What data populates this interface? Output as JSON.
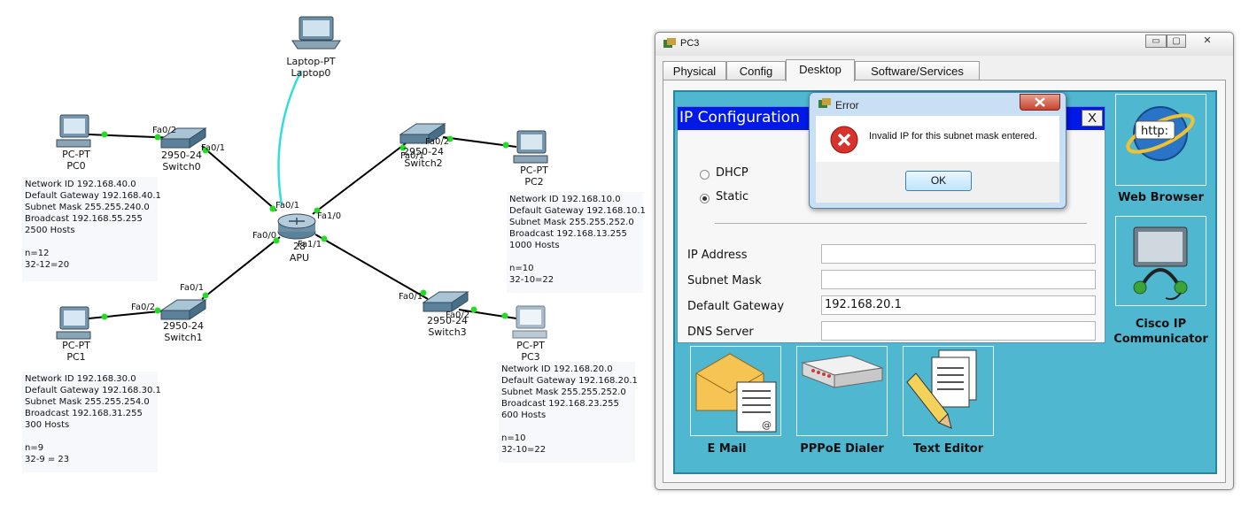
{
  "topology": {
    "devices": {
      "laptop0": {
        "type": "Laptop-PT",
        "name": "Laptop0"
      },
      "pc0": {
        "type": "PC-PT",
        "name": "PC0"
      },
      "pc1": {
        "type": "PC-PT",
        "name": "PC1"
      },
      "pc2": {
        "type": "PC-PT",
        "name": "PC2"
      },
      "pc3": {
        "type": "PC-PT",
        "name": "PC3"
      },
      "switch0": {
        "type": "2950-24",
        "name": "Switch0"
      },
      "switch1": {
        "type": "2950-24",
        "name": "Switch1"
      },
      "switch2": {
        "type": "2950-24",
        "name": "Switch2"
      },
      "switch3": {
        "type": "2950-24",
        "name": "Switch3"
      },
      "router": {
        "type": "28",
        "name": "APU"
      }
    },
    "ports": {
      "sw0_fa02": "Fa0/2",
      "sw0_fa01": "Fa0/1",
      "sw1_fa02": "Fa0/2",
      "sw1_fa01": "Fa0/1",
      "sw2_fa02": "Fa0/2",
      "sw2_fa01": "Fa0/1",
      "sw3_fa01": "Fa0/1",
      "sw3_fa02": "Fa0/2",
      "r_fa01": "Fa0/1",
      "r_fa10": "Fa1/0",
      "r_fa00": "Fa0/0",
      "r_fa11": "Fa1/1"
    },
    "notes": {
      "pc0": "Network ID 192.168.40.0\nDefault Gateway 192.168.40.1\nSubnet Mask 255.255.240.0\nBroadcast 192.168.55.255\n2500 Hosts\n\nn=12\n32-12=20",
      "pc1": "Network ID 192.168.30.0\nDefault Gateway 192.168.30.1\nSubnet Mask 255.255.254.0\nBroadcast 192.168.31.255\n300 Hosts\n\nn=9\n32-9 = 23",
      "pc2": "Network ID 192.168.10.0\nDefault Gateway 192.168.10.1\nSubnet Mask 255.255.252.0\nBroadcast 192.168.13.255\n1000 Hosts\n\nn=10\n32-10=22",
      "pc3": "Network ID 192.168.20.0\nDefault Gateway 192.168.20.1\nSubnet Mask 255.255.252.0\nBroadcast 192.168.23.255\n600 Hosts\n\nn=10\n32-10=22"
    }
  },
  "window": {
    "title": "PC3",
    "controls": {
      "minimize": "▭",
      "restore": "▢",
      "close": "✕"
    },
    "tabs": [
      "Physical",
      "Config",
      "Desktop",
      "Software/Services"
    ],
    "active_tab": "Desktop"
  },
  "ip_config": {
    "title": "IP Configuration",
    "close": "X",
    "dhcp_label": "DHCP",
    "static_label": "Static",
    "mode": "Static",
    "fields": {
      "ip_address": {
        "label": "IP Address",
        "value": ""
      },
      "subnet_mask": {
        "label": "Subnet Mask",
        "value": ""
      },
      "default_gateway": {
        "label": "Default Gateway",
        "value": "192.168.20.1"
      },
      "dns_server": {
        "label": "DNS Server",
        "value": ""
      }
    }
  },
  "apps": {
    "web_browser": "Web Browser",
    "browser_icon_text": "http:",
    "cisco_ip": "Cisco IP\nCommunicator",
    "email": "E Mail",
    "pppoe": "PPPoE Dialer",
    "text_editor": "Text Editor"
  },
  "error_dialog": {
    "title": "Error",
    "message": "Invalid IP for this subnet mask entered.",
    "ok": "OK"
  },
  "colors": {
    "desktop_bg": "#4fb8d0",
    "ipconfig_title": "#0018e8",
    "link_green": "#22dd22",
    "laptop_link": "#33dddd"
  }
}
